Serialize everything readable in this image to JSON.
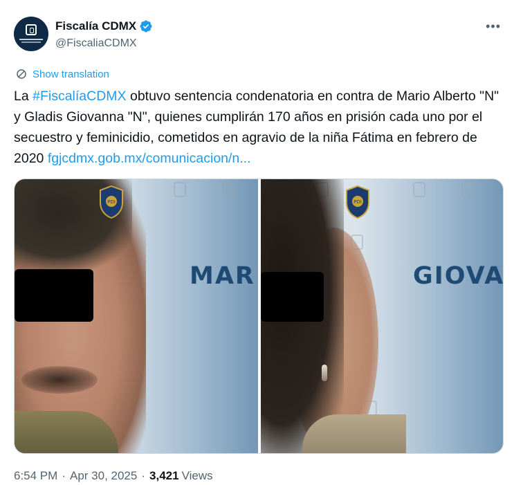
{
  "account": {
    "display_name": "Fiscalía CDMX",
    "handle": "@FiscaliaCDMX",
    "verified": true,
    "avatar_icon": "fiscalia-logo-icon"
  },
  "menu": {
    "more_label": "•••"
  },
  "translate": {
    "label": "Show translation",
    "icon": "globe-translate-icon"
  },
  "tweet": {
    "text_before": "La ",
    "hashtag": "#FiscalíaCDMX",
    "text_after": " obtuvo sentencia condenatoria en contra de Mario Alberto \"N\" y Gladis Giovanna \"N\", quienes cumplirán 170 años en prisión cada uno por el secuestro y feminicidio, cometidos en agravio de la niña Fátima en febrero de 2020 ",
    "link": "fgjcdmx.gob.mx/comunicacion/n..."
  },
  "media": {
    "left": {
      "banner": "MAR"
    },
    "right": {
      "banner": "GIOVA"
    }
  },
  "meta": {
    "time": "6:54 PM",
    "date": "Apr 30, 2025",
    "views_count": "3,421",
    "views_label": "Views",
    "separator": "·"
  },
  "colors": {
    "link": "#1d9bf0",
    "secondary_text": "#536471",
    "verified_badge": "#1d9bf0",
    "banner_text": "#1f4a73"
  }
}
